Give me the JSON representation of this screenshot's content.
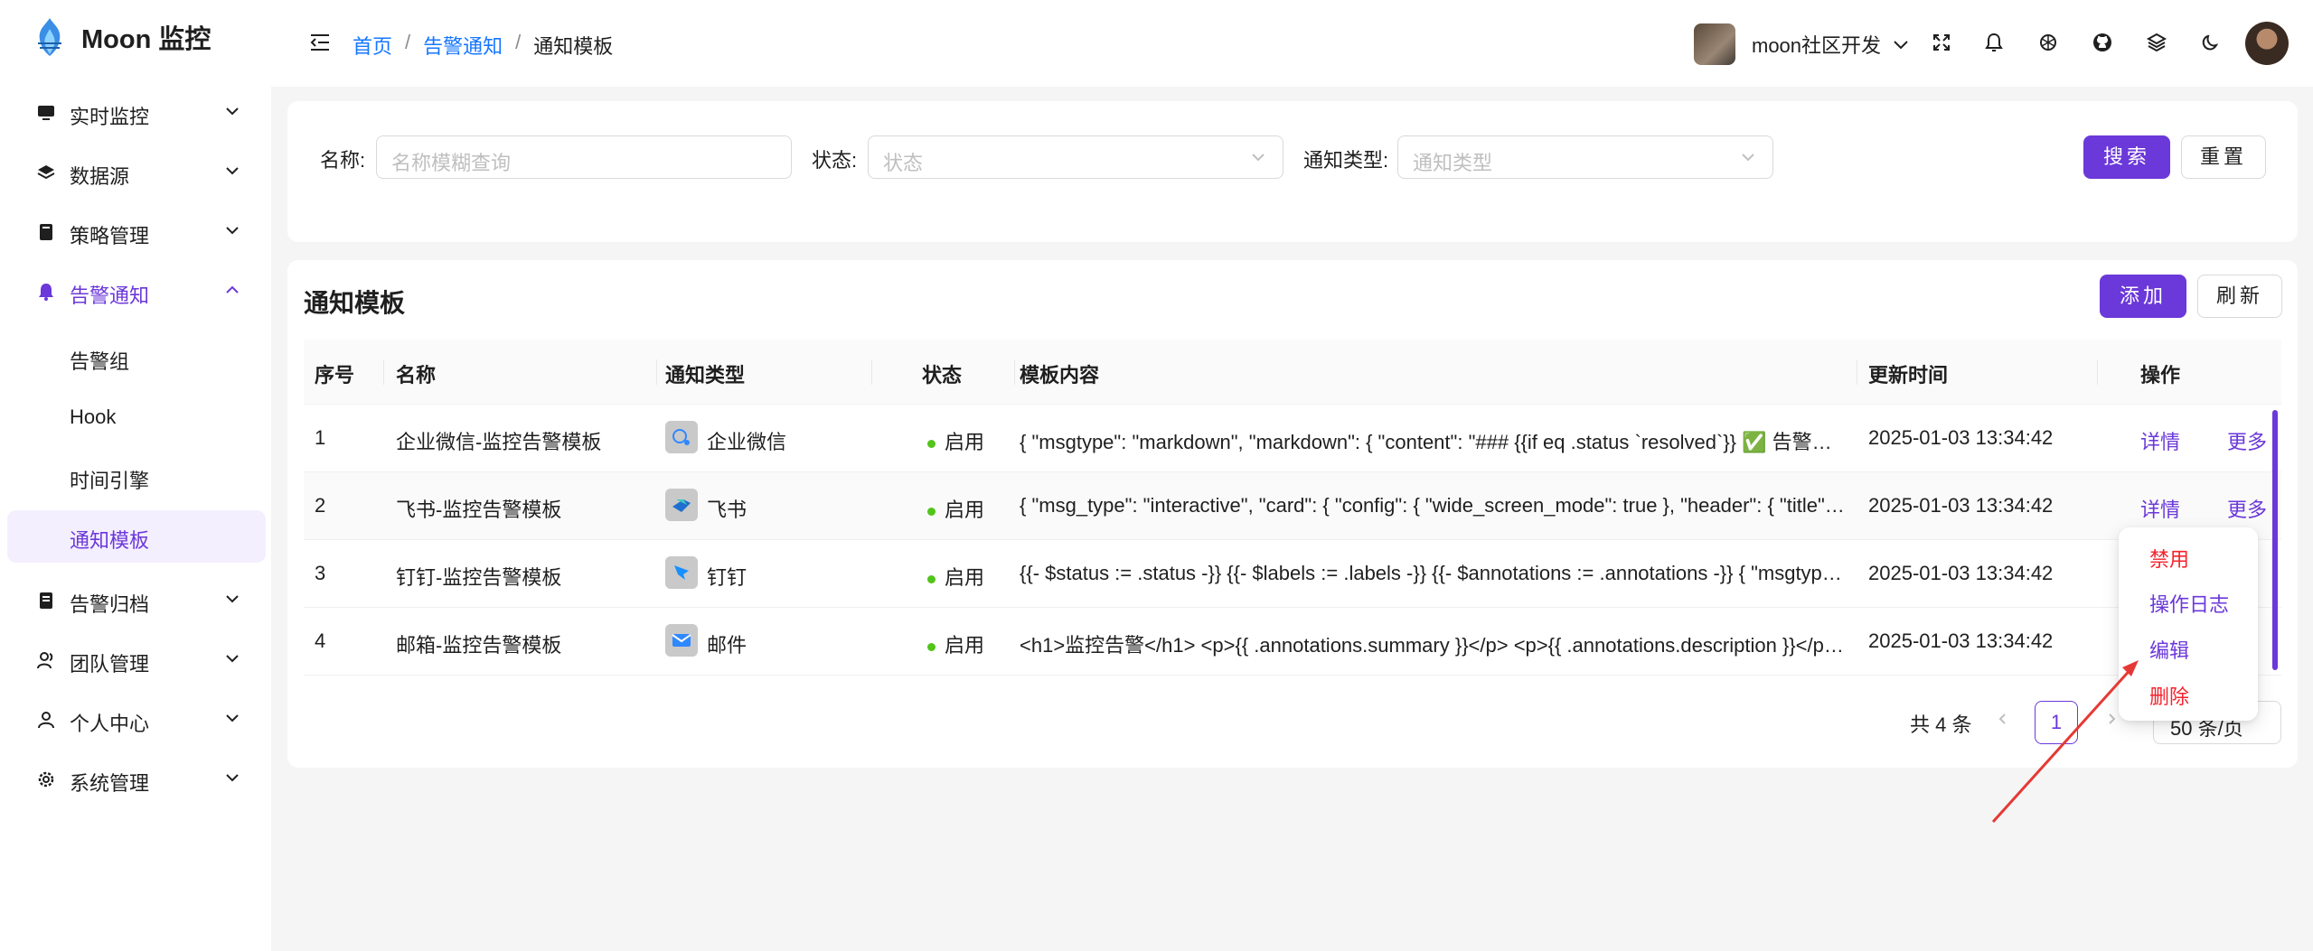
{
  "app": {
    "title": "Moon 监控"
  },
  "colors": {
    "primary": "#6b38d9",
    "link": "#1677ff",
    "success": "#52c41a",
    "danger": "#f5222d"
  },
  "sidebar": {
    "items": [
      {
        "label": "实时监控",
        "icon": "monitor-icon"
      },
      {
        "label": "数据源",
        "icon": "layers-icon"
      },
      {
        "label": "策略管理",
        "icon": "book-icon"
      },
      {
        "label": "告警通知",
        "icon": "bell-icon"
      },
      {
        "label": "告警归档",
        "icon": "archive-icon"
      },
      {
        "label": "团队管理",
        "icon": "team-icon"
      },
      {
        "label": "个人中心",
        "icon": "user-icon"
      },
      {
        "label": "系统管理",
        "icon": "gear-icon"
      }
    ],
    "sub_items": [
      "告警组",
      "Hook",
      "时间引擎",
      "通知模板"
    ]
  },
  "header": {
    "breadcrumb": [
      "首页",
      "告警通知",
      "通知模板"
    ],
    "separator": "/",
    "user_name": "moon社区开发"
  },
  "search": {
    "name_label": "名称:",
    "name_placeholder": "名称模糊查询",
    "status_label": "状态:",
    "status_placeholder": "状态",
    "type_label": "通知类型:",
    "type_placeholder": "通知类型",
    "search_button": "搜索",
    "reset_button": "重置"
  },
  "table": {
    "title": "通知模板",
    "add_button": "添加",
    "refresh_button": "刷新",
    "columns": [
      "序号",
      "名称",
      "通知类型",
      "状态",
      "模板内容",
      "更新时间",
      "操作"
    ],
    "rows": [
      {
        "index": "1",
        "name": "企业微信-监控告警模板",
        "type": "企业微信",
        "type_icon": "wecom-icon",
        "status": "启用",
        "content": "{ \"msgtype\": \"markdown\", \"markdown\": { \"content\": \"### {{if eq .status `resolved`}} ✅ 告警已恢复...",
        "updated": "2025-01-03 13:34:42",
        "detail": "详情",
        "more": "更多"
      },
      {
        "index": "2",
        "name": "飞书-监控告警模板",
        "type": "飞书",
        "type_icon": "feishu-icon",
        "status": "启用",
        "content": "{ \"msg_type\": \"interactive\", \"card\": { \"config\": { \"wide_screen_mode\": true }, \"header\": { \"title\": { \"ta...",
        "updated": "2025-01-03 13:34:42",
        "detail": "详情",
        "more": "更多"
      },
      {
        "index": "3",
        "name": "钉钉-监控告警模板",
        "type": "钉钉",
        "type_icon": "dingtalk-icon",
        "status": "启用",
        "content": "{{- $status := .status -}} {{- $labels := .labels -}} {{- $annotations := .annotations -}} { \"msgtype\": \"m...",
        "updated": "2025-01-03 13:34:42",
        "detail": "",
        "more": ""
      },
      {
        "index": "4",
        "name": "邮箱-监控告警模板",
        "type": "邮件",
        "type_icon": "mail-icon",
        "status": "启用",
        "content": "<h1>监控告警</h1> <p>{{ .annotations.summary }}</p> <p>{{ .annotations.description }}</p> ...",
        "updated": "2025-01-03 13:34:42",
        "detail": "",
        "more": ""
      }
    ]
  },
  "pagination": {
    "total": "共 4 条",
    "current": "1",
    "page_size": "50 条/页"
  },
  "dropdown": {
    "items": [
      "禁用",
      "操作日志",
      "编辑",
      "删除"
    ]
  }
}
